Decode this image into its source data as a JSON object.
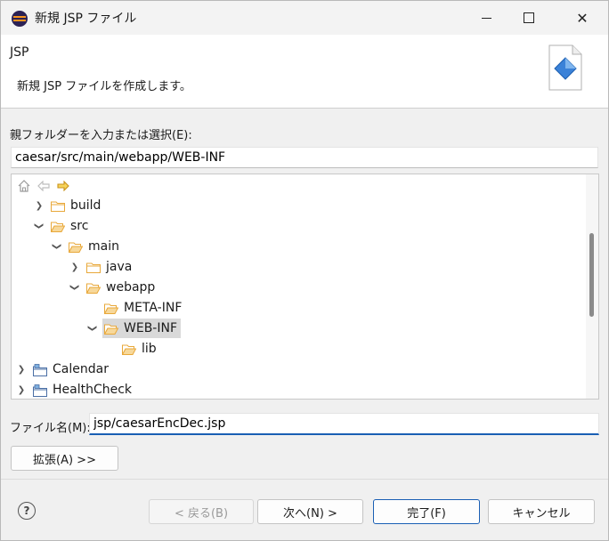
{
  "window": {
    "title": "新規 JSP ファイル"
  },
  "header": {
    "title": "JSP",
    "description": "新規 JSP ファイルを作成します。"
  },
  "parent_folder": {
    "label": "親フォルダーを入力または選択(E):",
    "value": "caesar/src/main/webapp/WEB-INF"
  },
  "tree": {
    "items": [
      {
        "label": "build",
        "expanded": false
      },
      {
        "label": "src",
        "expanded": true
      },
      {
        "label": "main",
        "expanded": true
      },
      {
        "label": "java",
        "expanded": false
      },
      {
        "label": "webapp",
        "expanded": true
      },
      {
        "label": "META-INF"
      },
      {
        "label": "WEB-INF",
        "expanded": true,
        "selected": true
      },
      {
        "label": "lib"
      },
      {
        "label": "Calendar",
        "expanded": false
      },
      {
        "label": "HealthCheck",
        "expanded": false
      }
    ]
  },
  "file_name": {
    "label": "ファイル名(M):",
    "value": "jsp/caesarEncDec.jsp"
  },
  "buttons": {
    "advanced": "拡張(A) >>",
    "back": "< 戻る(B)",
    "next": "次へ(N) >",
    "finish": "完了(F)",
    "cancel": "キャンセル"
  },
  "colors": {
    "focus_border": "#1a5fb4",
    "folder": "#e8a83a",
    "selection": "#d9d9d9"
  }
}
